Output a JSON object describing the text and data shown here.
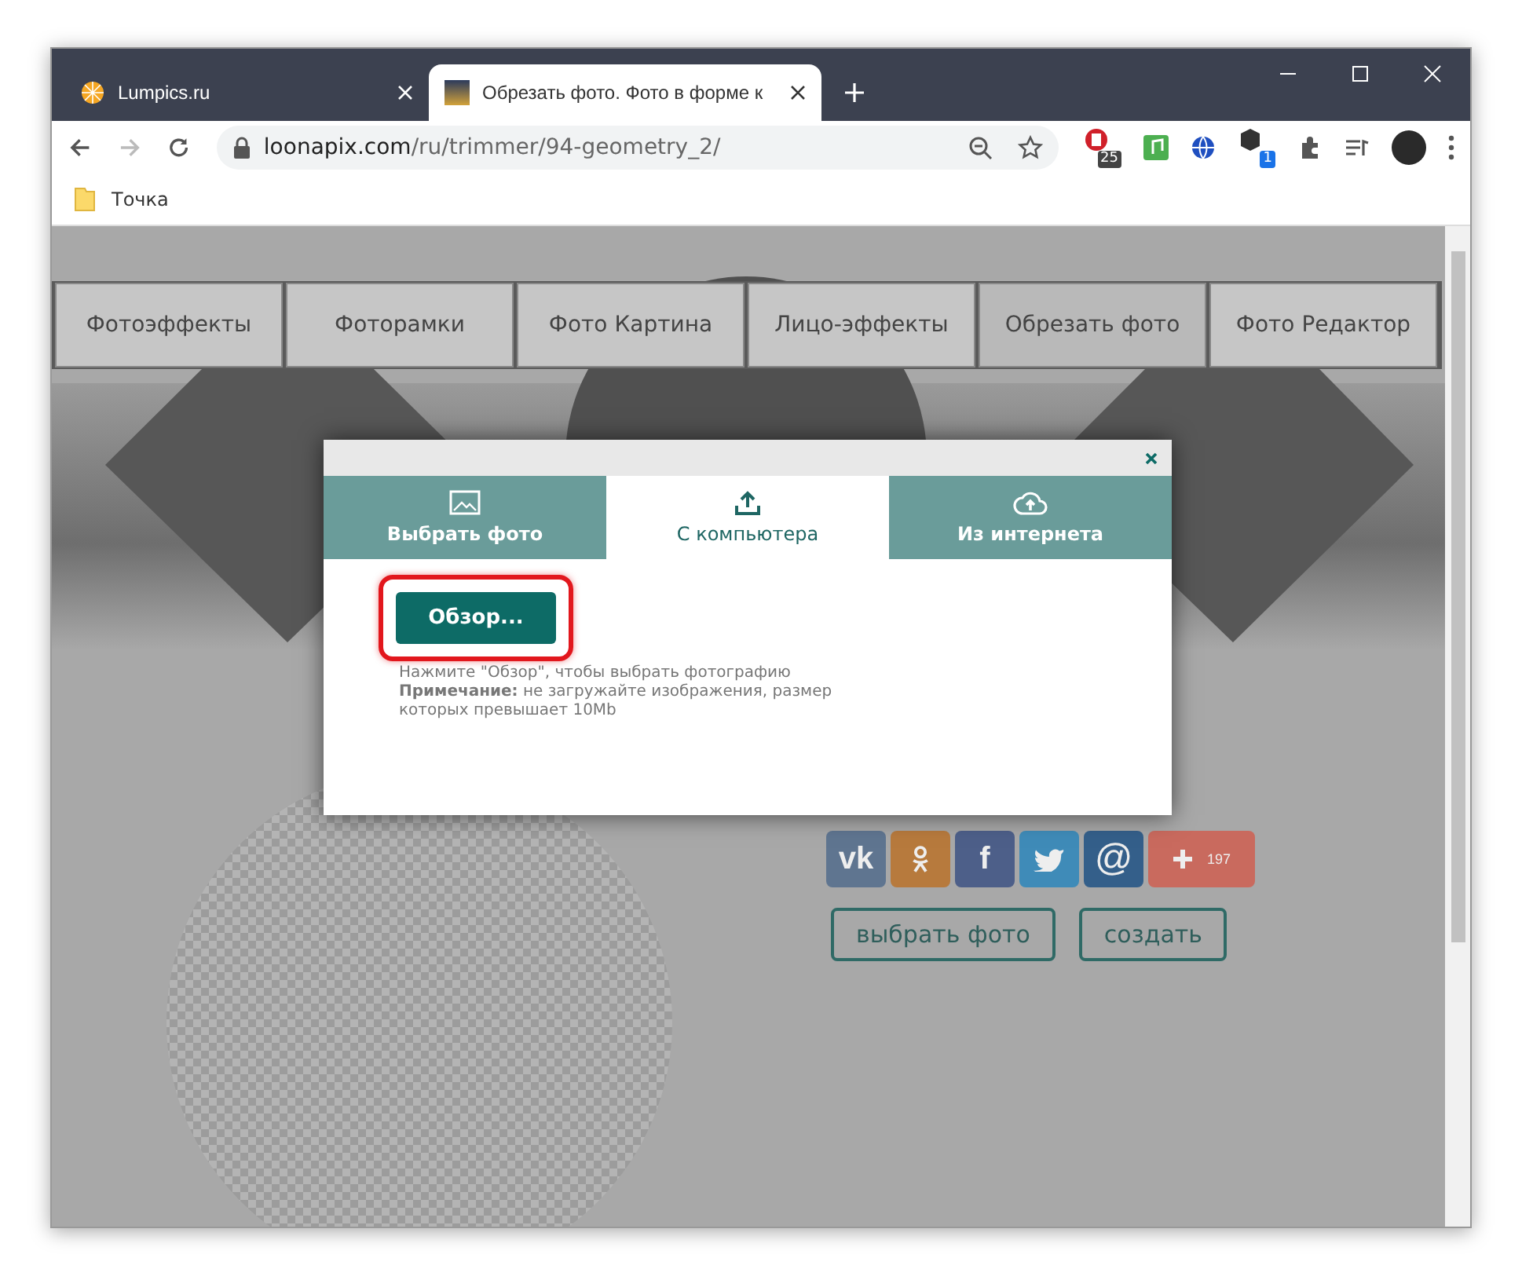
{
  "browser_tabs": [
    {
      "title": "Lumpics.ru",
      "selected": false
    },
    {
      "title": "Обрезать фото. Фото в форме к",
      "selected": true
    }
  ],
  "address": {
    "host": "loonapix.com",
    "path": "/ru/trimmer/94-geometry_2/"
  },
  "extension_badges": [
    "25",
    "1"
  ],
  "bookmarks": [
    "Точка"
  ],
  "nav": [
    {
      "label": "Фотоэффекты",
      "selected": false
    },
    {
      "label": "Фоторамки",
      "selected": false
    },
    {
      "label": "Фото Картина",
      "selected": false
    },
    {
      "label": "Лицо-эффекты",
      "selected": false
    },
    {
      "label": "Обрезать фото",
      "selected": true
    },
    {
      "label": "Фото Редактор",
      "selected": false
    }
  ],
  "modal": {
    "tabs": [
      {
        "kind": "image",
        "label": "Выбрать фото",
        "selected": false
      },
      {
        "kind": "upload",
        "label": "С компьютера",
        "selected": true
      },
      {
        "kind": "cloud",
        "label": "Из интернета",
        "selected": false
      }
    ],
    "browse_button": {
      "label": "Обзор...",
      "highlighted": true
    },
    "hint": "Нажмите \"Обзор\", чтобы выбрать фотографию",
    "note": "**Примечание:** не загружайте изображения, размер которых превышает 10Mb"
  },
  "share": [
    {
      "kind": "vk",
      "color": "#5f7590",
      "glyph": "vk"
    },
    {
      "kind": "ok",
      "color": "#b77a3d"
    },
    {
      "kind": "fb",
      "color": "#4d5f89",
      "glyph": "f"
    },
    {
      "kind": "tw",
      "color": "#3f8bb8"
    },
    {
      "kind": "mail",
      "color": "#345f8a",
      "glyph": "@"
    },
    {
      "kind": "plus",
      "color": "#c96a5e",
      "count": "197"
    }
  ],
  "actions": [
    "выбрать фото",
    "создать"
  ]
}
